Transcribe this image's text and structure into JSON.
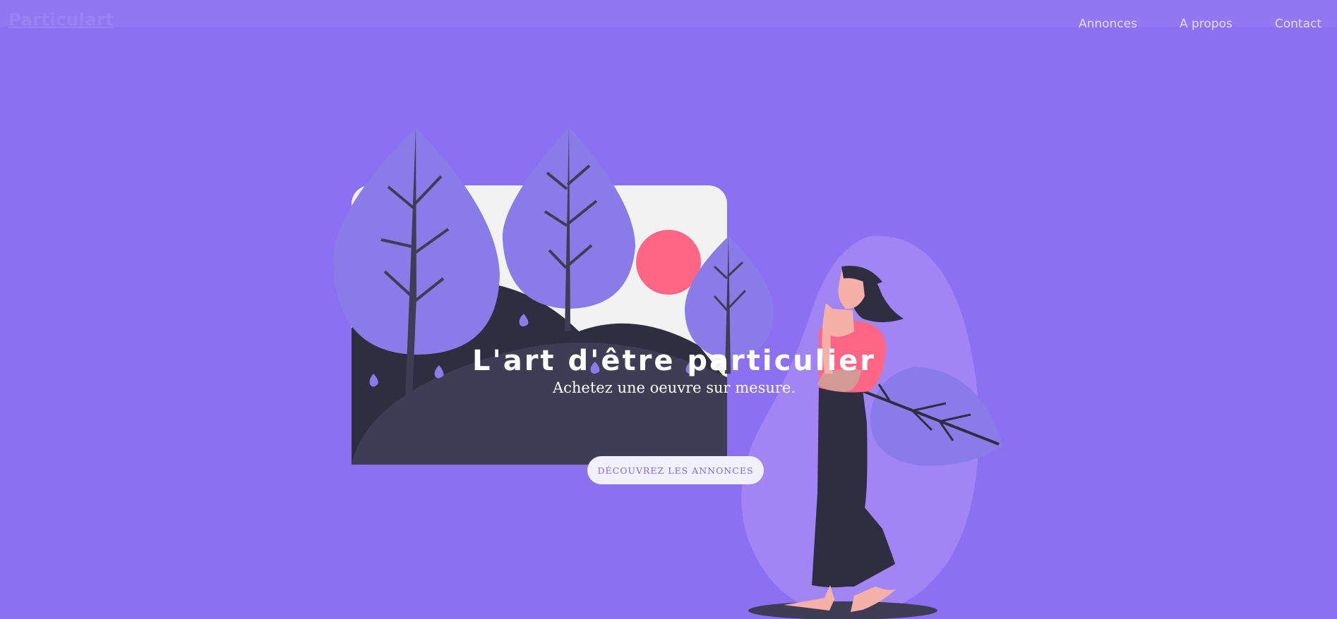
{
  "header": {
    "logo": "Particulart",
    "nav": [
      "Annonces",
      "A propos",
      "Contact"
    ]
  },
  "hero": {
    "title": "L'art d'être particulier",
    "subtitle": "Achetez une oeuvre sur mesure.",
    "cta_label": "DÉCOUVREZ LES ANNONCES"
  },
  "colors": {
    "background": "#8b70f2",
    "accent": "#ff6584",
    "dark": "#2f2e41",
    "button": "#f3f0fe",
    "button_text": "#7f6ae3"
  },
  "icons": [
    "tree-icon",
    "sun-icon",
    "woman-figure",
    "leaf-icon"
  ]
}
